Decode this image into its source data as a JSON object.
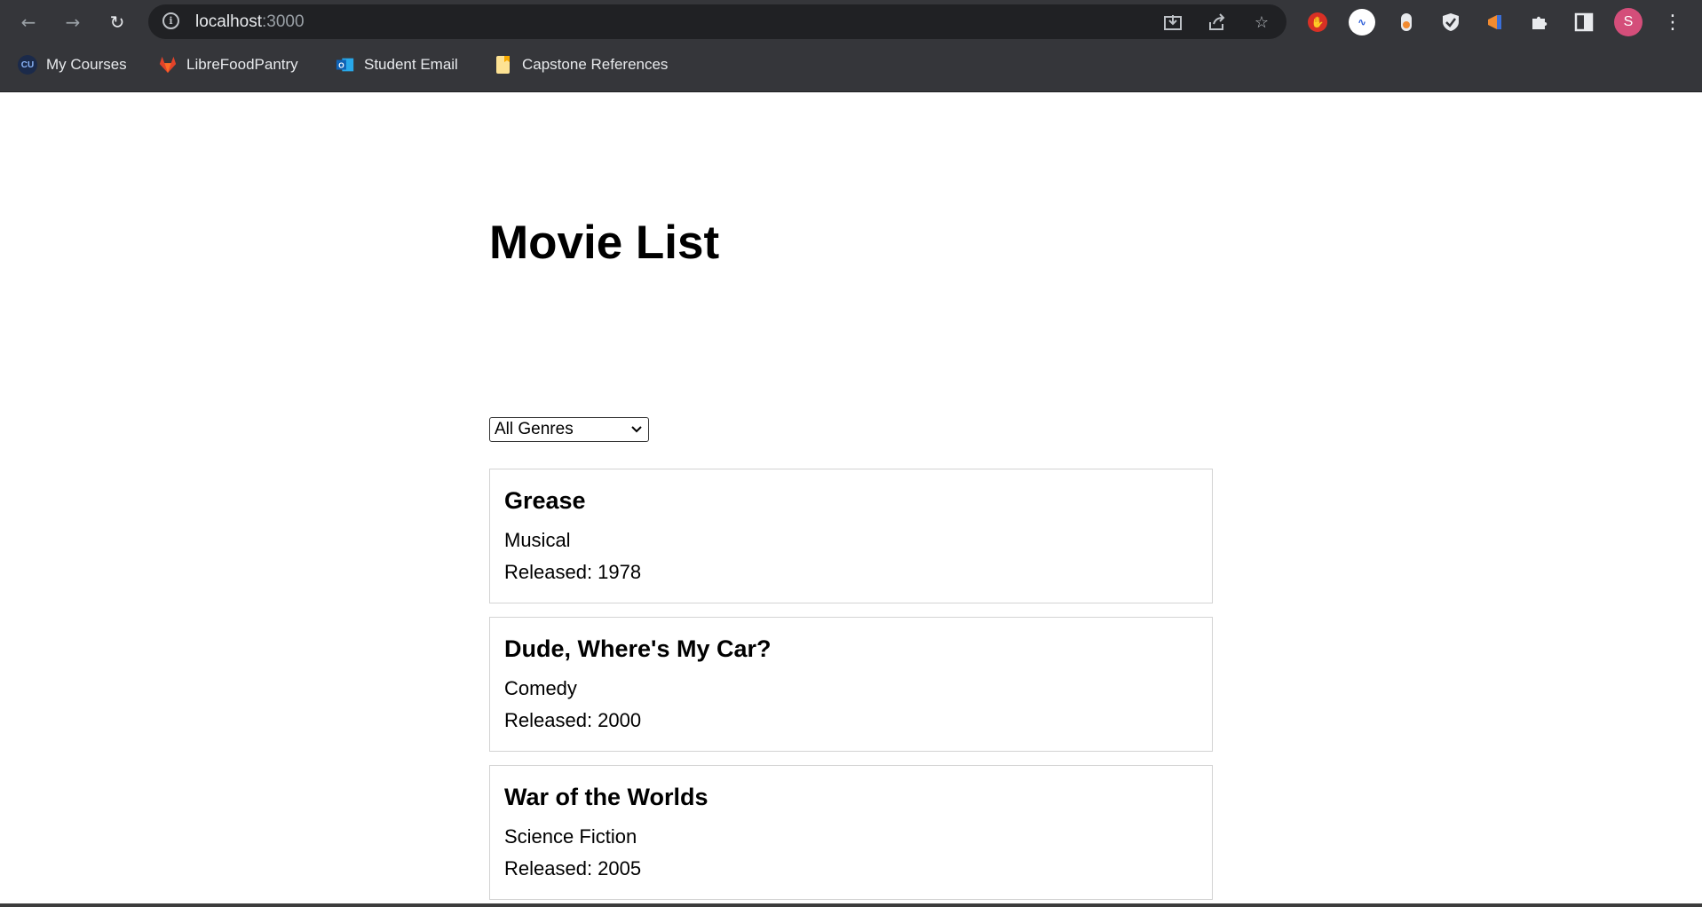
{
  "browser": {
    "url_host": "localhost",
    "url_port": ":3000",
    "profile_initial": "S",
    "bookmarks": [
      {
        "label": "My Courses",
        "icon": "cu-icon"
      },
      {
        "label": "LibreFoodPantry",
        "icon": "gitlab-icon"
      },
      {
        "label": "Student Email",
        "icon": "outlook-icon"
      },
      {
        "label": "Capstone References",
        "icon": "folder-icon"
      }
    ]
  },
  "page": {
    "title": "Movie List",
    "filter": {
      "selected": "All Genres"
    },
    "movies": [
      {
        "title": "Grease",
        "genre": "Musical",
        "released": "Released: 1978"
      },
      {
        "title": "Dude, Where's My Car?",
        "genre": "Comedy",
        "released": "Released: 2000"
      },
      {
        "title": "War of the Worlds",
        "genre": "Science Fiction",
        "released": "Released: 2005"
      }
    ]
  },
  "colors": {
    "chrome_bg": "#35363a",
    "omnibox_bg": "#202124",
    "profile": "#d44e7a",
    "card_border": "#d3d3d3"
  }
}
